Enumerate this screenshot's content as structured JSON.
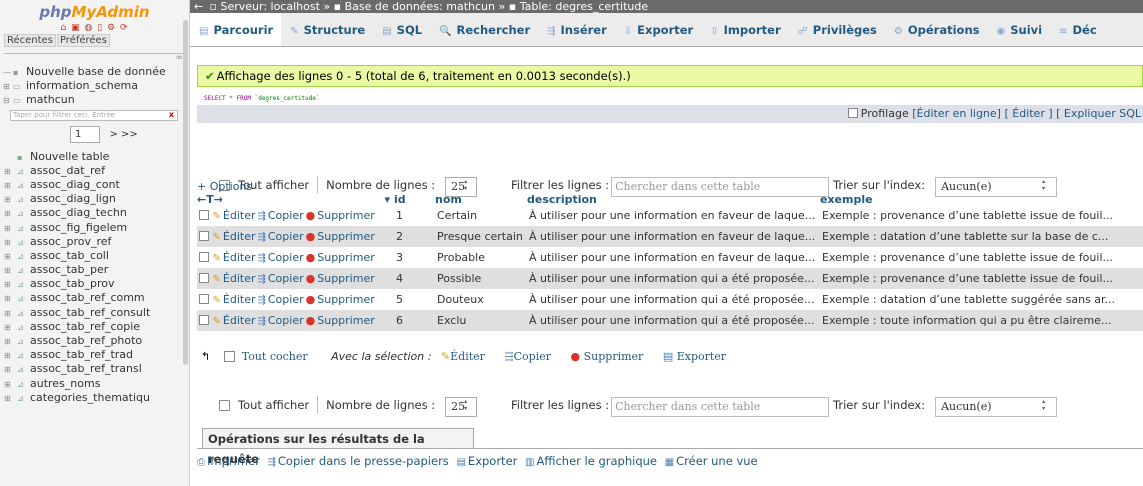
{
  "logo": {
    "php": "php",
    "mya": "MyAdmin"
  },
  "left": {
    "recent_tab": "Récentes",
    "favorites_tab": "Préférées",
    "new_db": "Nouvelle base de donnée",
    "db1": "information_schema",
    "db2": "mathcun",
    "filter_placeholder": "Taper pour filtrer ceci, Entrée",
    "page_num": "1",
    "page_nav": "> >>",
    "new_table": "Nouvelle table",
    "tables": [
      "assoc_dat_ref",
      "assoc_diag_cont",
      "assoc_diag_lign",
      "assoc_diag_techn",
      "assoc_fig_figelem",
      "assoc_prov_ref",
      "assoc_tab_coll",
      "assoc_tab_per",
      "assoc_tab_prov",
      "assoc_tab_ref_comm",
      "assoc_tab_ref_consult",
      "assoc_tab_ref_copie",
      "assoc_tab_ref_photo",
      "assoc_tab_ref_trad",
      "assoc_tab_ref_transl",
      "autres_noms",
      "categories_thematiqu"
    ]
  },
  "breadcrumb": {
    "server": "Serveur: localhost",
    "db": "Base de données: mathcun",
    "table": "Table: degres_certitude",
    "sep": "»"
  },
  "tabs": [
    "Parcourir",
    "Structure",
    "SQL",
    "Rechercher",
    "Insérer",
    "Exporter",
    "Importer",
    "Privilèges",
    "Opérations",
    "Suivi",
    "Déc"
  ],
  "tab_icons": [
    "▤",
    "✎",
    "▤",
    "🔍",
    "⇶",
    "⇩",
    "⇧",
    "☍",
    "⚙",
    "◉",
    "≡"
  ],
  "success": "Affichage des lignes 0 - 5 (total de 6, traitement en 0.0013 seconde(s).)",
  "sql": {
    "select": "SELECT",
    "star": " * ",
    "from": "FROM",
    "table": " `degres_certitude`"
  },
  "profiling": {
    "label": "Profilage",
    "edit_inline": "[Éditer en ligne]",
    "edit": "[ Éditer ]",
    "explain": "[ Expliquer SQL"
  },
  "controls": {
    "show_all": "Tout afficher",
    "rows_label": "Nombre de lignes :",
    "rows_value": "25",
    "filter_label": "Filtrer les lignes :",
    "filter_placeholder": "Chercher dans cette table",
    "sort_label": "Trier sur l'index:",
    "sort_value": "Aucun(e)"
  },
  "options": "+ Options",
  "columns": {
    "arrows": "←T→",
    "sort": "▾",
    "id": "id",
    "nom": "nom",
    "description": "description",
    "exemple": "exemple"
  },
  "actions": {
    "edit": "Éditer",
    "copy": "Copier",
    "delete": "Supprimer"
  },
  "rows": [
    {
      "id": "1",
      "nom": "Certain",
      "description": "À utiliser pour une information en faveur de laque...",
      "exemple": "Exemple : provenance d’une tablette issue de fouil..."
    },
    {
      "id": "2",
      "nom": "Presque certain",
      "description": "À utiliser pour une information en faveur de laque...",
      "exemple": "Exemple : datation d’une tablette sur la base de c..."
    },
    {
      "id": "3",
      "nom": "Probable",
      "description": "À utiliser pour une information en faveur de laque...",
      "exemple": "Exemple : provenance d’une tablette issue de fouil..."
    },
    {
      "id": "4",
      "nom": "Possible",
      "description": "À utiliser pour une information qui a été proposée...",
      "exemple": "Exemple : provenance d’une tablette issue de fouil..."
    },
    {
      "id": "5",
      "nom": "Douteux",
      "description": "À utiliser pour une information qui a été proposée...",
      "exemple": "Exemple : datation d’une tablette suggérée sans ar..."
    },
    {
      "id": "6",
      "nom": "Exclu",
      "description": "À utiliser pour une information qui a été proposée...",
      "exemple": "Exemple : toute information qui a pu être claireme..."
    }
  ],
  "with_selection": {
    "check_all": "Tout cocher",
    "label": "Avec la sélection :",
    "edit": "Éditer",
    "copy": "Copier",
    "delete": "Supprimer",
    "export": "Exporter"
  },
  "query_ops": {
    "title": "Opérations sur les résultats de la requête",
    "print": "Imprimer",
    "copy": "Copier dans le presse-papiers",
    "export": "Exporter",
    "chart": "Afficher le graphique",
    "view": "Créer une vue"
  }
}
